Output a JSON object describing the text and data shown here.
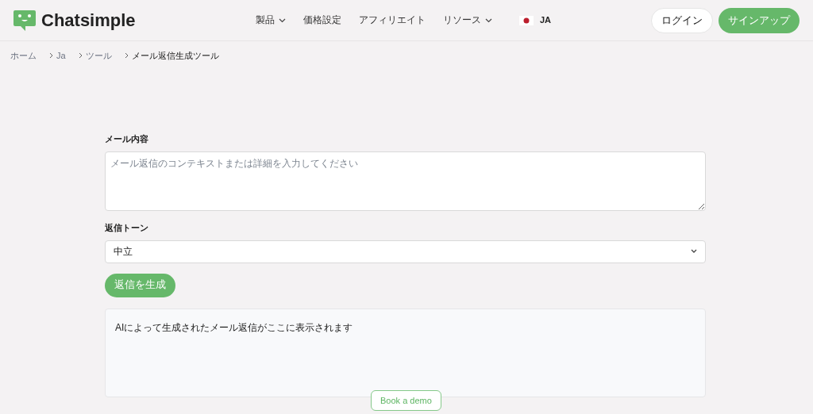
{
  "header": {
    "brand": "Chatsimple",
    "nav": [
      {
        "label": "製品",
        "dropdown": true
      },
      {
        "label": "価格設定",
        "dropdown": false
      },
      {
        "label": "アフィリエイト",
        "dropdown": false
      },
      {
        "label": "リソース",
        "dropdown": true
      }
    ],
    "language": "JA",
    "login": "ログイン",
    "signup": "サインアップ"
  },
  "breadcrumbs": [
    {
      "label": "ホーム",
      "current": false
    },
    {
      "label": "Ja",
      "current": false
    },
    {
      "label": "ツール",
      "current": false
    },
    {
      "label": "メール返信生成ツール",
      "current": true
    }
  ],
  "form": {
    "content_label": "メール内容",
    "content_placeholder": "メール返信のコンテキストまたは詳細を入力してください",
    "tone_label": "返信トーン",
    "tone_value": "中立",
    "generate": "返信を生成",
    "output": "AIによって生成されたメール返信がここに表示されます"
  },
  "book_demo": "Book a demo"
}
